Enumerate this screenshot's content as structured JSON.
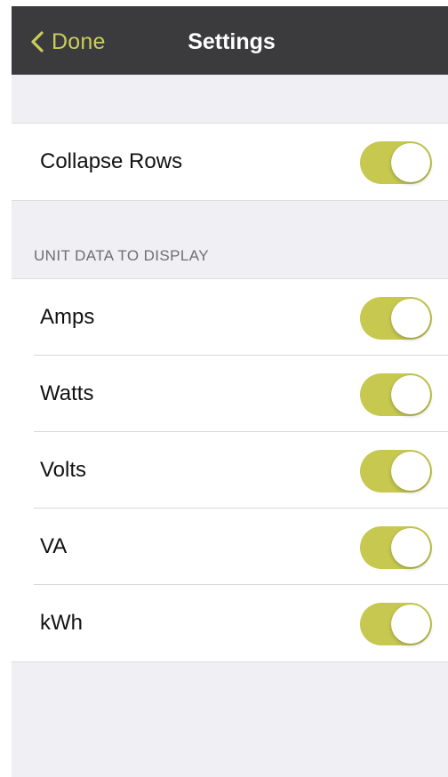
{
  "navbar": {
    "back_label": "Done",
    "title": "Settings",
    "accent_color": "#c9cd5a",
    "background_color": "#3b3b3e"
  },
  "general": {
    "rows": [
      {
        "label": "Collapse Rows",
        "enabled": true
      }
    ]
  },
  "unit_data": {
    "header": "UNIT DATA TO DISPLAY",
    "rows": [
      {
        "label": "Amps",
        "enabled": true
      },
      {
        "label": "Watts",
        "enabled": true
      },
      {
        "label": "Volts",
        "enabled": true
      },
      {
        "label": "VA",
        "enabled": true
      },
      {
        "label": "kWh",
        "enabled": true
      }
    ]
  },
  "toggle_on_color": "#c6c84f",
  "icons": {
    "back": "chevron-left-icon"
  }
}
